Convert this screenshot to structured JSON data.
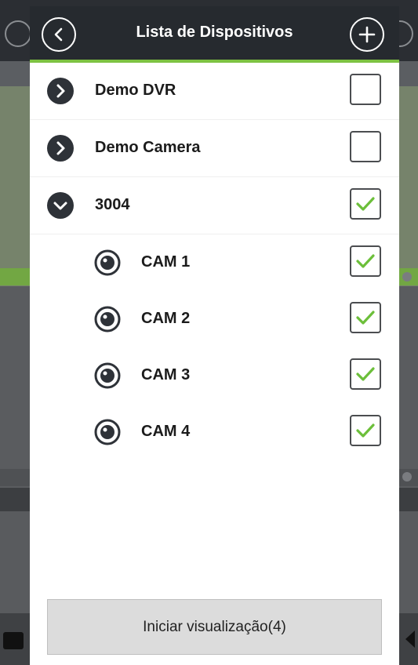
{
  "header": {
    "title": "Lista de Dispositivos",
    "back_icon": "chevron-left-icon",
    "add_icon": "plus-icon"
  },
  "devices": [
    {
      "label": "Demo DVR",
      "expanded": false,
      "checked": false,
      "icon": "chevron-right-icon"
    },
    {
      "label": "Demo Camera",
      "expanded": false,
      "checked": false,
      "icon": "chevron-right-icon"
    },
    {
      "label": "3004",
      "expanded": true,
      "checked": true,
      "icon": "chevron-down-icon",
      "channels": [
        {
          "label": "CAM 1",
          "checked": true,
          "icon": "camera-lens-icon"
        },
        {
          "label": "CAM 2",
          "checked": true,
          "icon": "camera-lens-icon"
        },
        {
          "label": "CAM 3",
          "checked": true,
          "icon": "camera-lens-icon"
        },
        {
          "label": "CAM 4",
          "checked": true,
          "icon": "camera-lens-icon"
        }
      ]
    }
  ],
  "footer": {
    "start_label": "Iniciar visualização(4)"
  },
  "colors": {
    "header_bg": "#262a2f",
    "accent_green": "#7dc242",
    "check_green": "#6cbf3a"
  }
}
